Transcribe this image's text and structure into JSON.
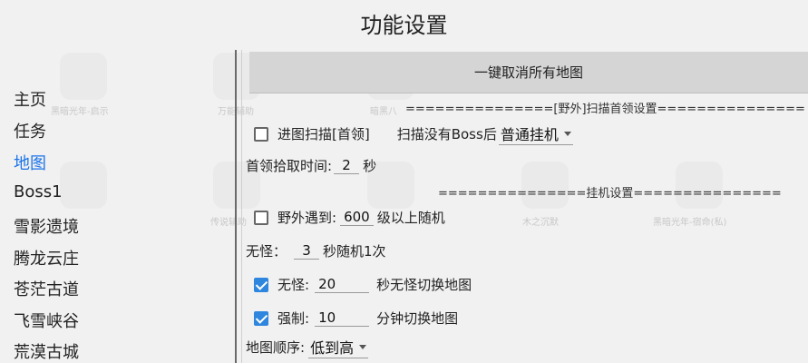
{
  "title": "功能设置",
  "sidebar": {
    "items": [
      {
        "label": "主页"
      },
      {
        "label": "任务"
      },
      {
        "label": "地图"
      },
      {
        "label": "Boss1"
      },
      {
        "label": "雪影遗境"
      },
      {
        "label": "腾龙云庄"
      },
      {
        "label": "苍茫古道"
      },
      {
        "label": "飞雪峡谷"
      },
      {
        "label": "荒漠古城"
      }
    ],
    "active_index": 2
  },
  "background_apps": [
    {
      "label": "黑暗光年-启示"
    },
    {
      "label": "万能辅助"
    },
    {
      "label": "暗黑八"
    },
    {
      "label": "传说辅助"
    },
    {
      "label": "木之沉默"
    },
    {
      "label": "黑暗光年-宿命(私)"
    }
  ],
  "main": {
    "cancel_all_button": "一键取消所有地图",
    "section_field_scan": "===============[野外]扫描首领设置===============",
    "scan_checkbox_label": "进图扫描[首领]",
    "scan_checkbox_checked": false,
    "no_boss_label": "扫描没有Boss后",
    "no_boss_select": "普通挂机",
    "pickup_label": "首领拾取时间:",
    "pickup_value": "2",
    "pickup_unit": "秒",
    "section_hangup": "===============挂机设置===============",
    "field_meet_label": "野外遇到:",
    "field_meet_checked": false,
    "field_meet_value": "600",
    "field_meet_suffix": "级以上随机",
    "no_monster_label": "无怪：",
    "no_monster_value": "3",
    "no_monster_suffix": "秒随机1次",
    "no_monster_switch_label": "无怪:",
    "no_monster_switch_checked": true,
    "no_monster_switch_value": "20",
    "no_monster_switch_suffix": "秒无怪切换地图",
    "force_label": "强制:",
    "force_checked": true,
    "force_value": "10",
    "force_suffix": "分钟切换地图",
    "map_order_label": "地图顺序:",
    "map_order_select": "低到高"
  },
  "colors": {
    "accent": "#1a73e8",
    "checkbox_checked": "#2e86de",
    "button_bg": "#d5d5d5"
  }
}
